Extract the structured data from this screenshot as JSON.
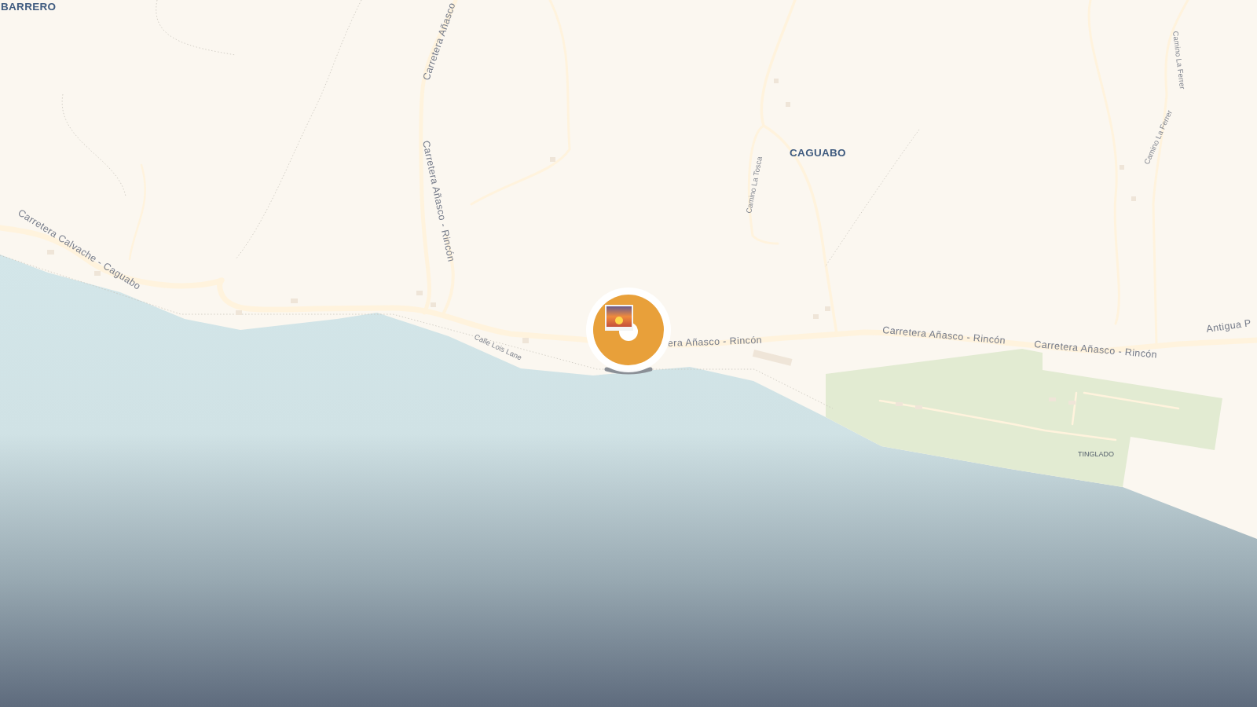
{
  "map": {
    "labels": [
      {
        "kind": "place",
        "text": "BARRERO"
      },
      {
        "kind": "road",
        "text": "Carretera Añasco"
      },
      {
        "kind": "road",
        "text": "Carretera Añasco - Rincón"
      },
      {
        "kind": "road",
        "text": "Carretera Calvache - Caguabo"
      },
      {
        "kind": "place",
        "text": "CAGUABO"
      },
      {
        "kind": "minor",
        "text": "Camino La Tosca"
      },
      {
        "kind": "minor",
        "text": "Camino La Ferrer"
      },
      {
        "kind": "minor",
        "text": "Camino La Ferrer"
      },
      {
        "kind": "road",
        "text": "Antigua P"
      },
      {
        "kind": "minor",
        "text": "Calle Lois Lane"
      },
      {
        "kind": "road",
        "text": "era Añasco - Rincón"
      },
      {
        "kind": "road",
        "text": "Carretera Añasco - Rincón"
      },
      {
        "kind": "road",
        "text": "Carretera Añasco - Rincón"
      },
      {
        "kind": "area",
        "text": "TINGLADO"
      }
    ]
  }
}
